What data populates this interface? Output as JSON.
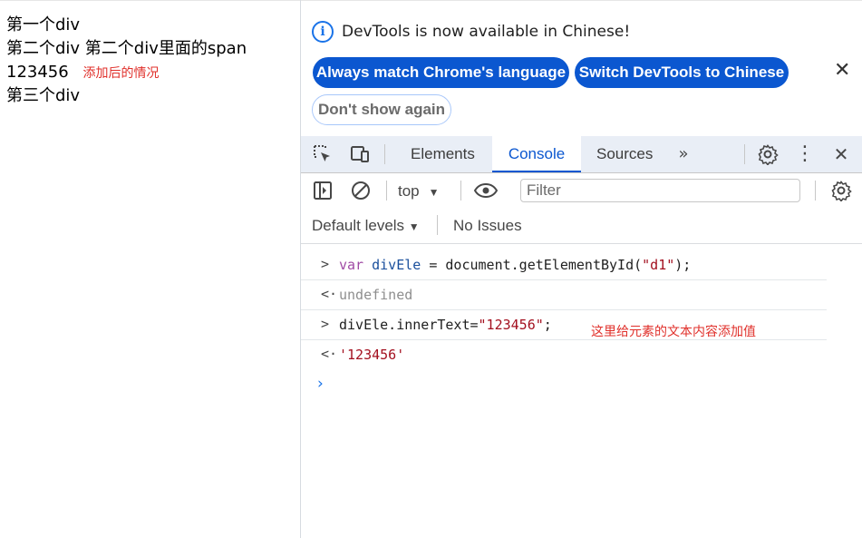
{
  "page": {
    "line1": "第一个div",
    "line2": "第二个div 第二个div里面的span",
    "line3": "123456",
    "line3_note": "添加后的情况",
    "line4": "第三个div"
  },
  "banner": {
    "icon": "info-icon",
    "message": "DevTools is now available in Chinese!",
    "btn_match": "Always match Chrome's language",
    "btn_switch": "Switch DevTools to Chinese",
    "btn_dont_show": "Don't show again"
  },
  "tabs": {
    "elements": "Elements",
    "console": "Console",
    "sources": "Sources"
  },
  "toolbar": {
    "context": "top",
    "filter_placeholder": "Filter",
    "levels": "Default levels",
    "issues": "No Issues"
  },
  "console": {
    "rows": [
      {
        "kind": "input",
        "kw": "var",
        "ident": "divEle",
        "rest": " = document.getElementById(",
        "str": "\"d1\"",
        "tail": ");"
      },
      {
        "kind": "output",
        "text": "undefined"
      },
      {
        "kind": "input",
        "pre": "divEle.innerText=",
        "str": "\"123456\"",
        "tail": ";"
      },
      {
        "kind": "output",
        "text": "'123456'"
      }
    ],
    "annotation": "这里给元素的文本内容添加值"
  },
  "colors": {
    "accent": "#0b57d0",
    "annotation": "#e0302b",
    "string": "#a3101f"
  }
}
